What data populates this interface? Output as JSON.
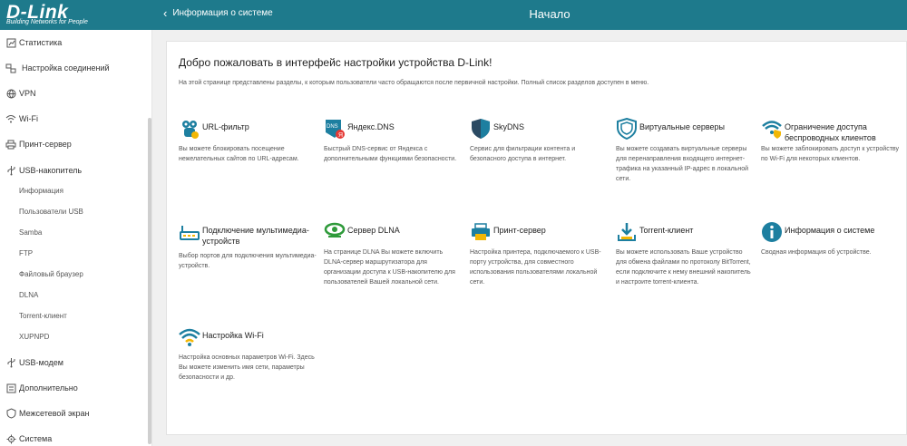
{
  "brand": {
    "logo": "D-Link",
    "tagline": "Building Networks for People"
  },
  "header": {
    "back_label": "Информация о системе",
    "title": "Начало"
  },
  "sidebar": {
    "items": [
      {
        "label": "Статистика",
        "icon": "stats-icon"
      },
      {
        "label": "Настройка соединений",
        "icon": "connections-icon"
      },
      {
        "label": "VPN",
        "icon": "vpn-icon"
      },
      {
        "label": "Wi-Fi",
        "icon": "wifi-icon"
      },
      {
        "label": "Принт-сервер",
        "icon": "printer-icon"
      },
      {
        "label": "USB-накопитель",
        "icon": "usb-icon"
      }
    ],
    "usb_subitems": [
      "Информация",
      "Пользователи USB",
      "Samba",
      "FTP",
      "Файловый браузер",
      "DLNA",
      "Torrent-клиент",
      "XUPNPD"
    ],
    "bottom_items": [
      {
        "label": "USB-модем",
        "icon": "usb-modem-icon"
      },
      {
        "label": "Дополнительно",
        "icon": "advanced-icon"
      },
      {
        "label": "Межсетевой экран",
        "icon": "firewall-icon"
      },
      {
        "label": "Система",
        "icon": "system-icon"
      }
    ]
  },
  "main": {
    "welcome": "Добро пожаловать в интерфейс настройки устройства D-Link!",
    "intro": "На этой странице представлены разделы, к которым пользователи часто обращаются после первичной настройки. Полный список разделов доступен в меню.",
    "tiles": [
      {
        "title": "URL-фильтр",
        "desc": "Вы можете блокировать посещение нежелательных сайтов по URL-адресам.",
        "icon": "url-filter-icon"
      },
      {
        "title": "Яндекс.DNS",
        "desc": "Быстрый DNS-сервис от Яндекса с дополнительными функциями безопасности.",
        "icon": "yandex-dns-icon"
      },
      {
        "title": "SkyDNS",
        "desc": "Сервис для фильтрации контента и безопасного доступа в интернет.",
        "icon": "skydns-shield-icon"
      },
      {
        "title": "Виртуальные серверы",
        "desc": "Вы можете создавать виртуальные серверы для перенаправления входящего интернет-трафика на указанный IP-адрес в локальной сети.",
        "icon": "virtual-servers-shield-icon"
      },
      {
        "title": "Ограничение доступа беспроводных клиентов",
        "desc": "Вы можете заблокировать доступ к устройству по Wi-Fi для некоторых клиентов.",
        "icon": "wifi-lock-icon"
      },
      {
        "title": "Подключение мультимедиа-устройств",
        "desc": "Выбор портов для подключения мультимедиа-устройств.",
        "icon": "multimedia-icon"
      },
      {
        "title": "Сервер DLNA",
        "desc": "На странице DLNA Вы можете включить DLNA-сервер маршрутизатора для организации доступа к USB-накопителю для пользователей Вашей локальной сети.",
        "icon": "dlna-icon"
      },
      {
        "title": "Принт-сервер",
        "desc": "Настройка принтера, подключаемого к USB-порту устройства, для совместного использования пользователями локальной сети.",
        "icon": "print-server-icon"
      },
      {
        "title": "Torrent-клиент",
        "desc": "Вы можете использовать Ваше устройство для обмена файлами по протоколу BitTorrent, если подключите к нему внешний накопитель и настроите torrent-клиента.",
        "icon": "torrent-download-icon"
      },
      {
        "title": "Информация о системе",
        "desc": "Сводная информация об устройстве.",
        "icon": "info-icon"
      },
      {
        "title": "Настройка Wi-Fi",
        "desc": "Настройка основных параметров Wi-Fi. Здесь Вы можете изменить имя сети, параметры безопасности и др.",
        "icon": "wifi-settings-icon"
      }
    ]
  },
  "colors": {
    "header": "#1e7a8c",
    "accent": "#1d7fa0",
    "green": "#2e9a3a",
    "yellow": "#f2b705"
  }
}
